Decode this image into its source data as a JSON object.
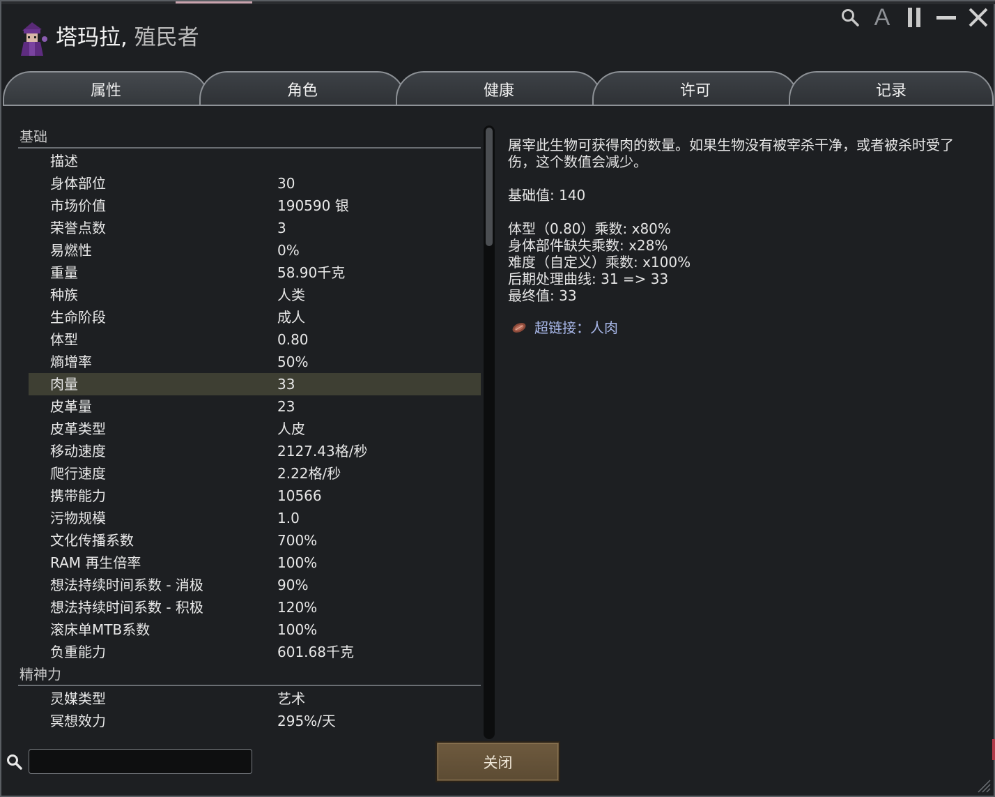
{
  "window": {
    "pawn_name": "塔玛拉",
    "separator": ",",
    "pawn_role": "殖民者",
    "controls": {
      "search_icon": "search-icon",
      "font_label": "A",
      "pause_icon": "pause-icon",
      "minimize_icon": "minimize-icon",
      "close_icon": "close-icon"
    }
  },
  "tabs": [
    {
      "label": "属性",
      "active": true
    },
    {
      "label": "角色",
      "active": false
    },
    {
      "label": "健康",
      "active": false
    },
    {
      "label": "许可",
      "active": false
    },
    {
      "label": "记录",
      "active": false
    }
  ],
  "stats": {
    "categories": [
      {
        "title": "基础",
        "rows": [
          {
            "label": "描述",
            "value": ""
          },
          {
            "label": "身体部位",
            "value": "30"
          },
          {
            "label": "市场价值",
            "value": "190590 银"
          },
          {
            "label": "荣誉点数",
            "value": "3"
          },
          {
            "label": "易燃性",
            "value": "0%"
          },
          {
            "label": "重量",
            "value": "58.90千克"
          },
          {
            "label": "种族",
            "value": "人类"
          },
          {
            "label": "生命阶段",
            "value": "成人"
          },
          {
            "label": "体型",
            "value": "0.80"
          },
          {
            "label": "熵增率",
            "value": "50%"
          },
          {
            "label": "肉量",
            "value": "33",
            "selected": true
          },
          {
            "label": "皮革量",
            "value": "23"
          },
          {
            "label": "皮革类型",
            "value": "人皮"
          },
          {
            "label": "移动速度",
            "value": "2127.43格/秒"
          },
          {
            "label": "爬行速度",
            "value": "2.22格/秒"
          },
          {
            "label": "携带能力",
            "value": "10566"
          },
          {
            "label": "污物规模",
            "value": "1.0"
          },
          {
            "label": "文化传播系数",
            "value": "700%"
          },
          {
            "label": "RAM 再生倍率",
            "value": "100%"
          },
          {
            "label": "想法持续时间系数 - 消极",
            "value": "90%"
          },
          {
            "label": "想法持续时间系数 - 积极",
            "value": "120%"
          },
          {
            "label": "滚床单MTB系数",
            "value": "100%"
          },
          {
            "label": "负重能力",
            "value": "601.68千克"
          }
        ]
      },
      {
        "title": "精神力",
        "rows": [
          {
            "label": "灵媒类型",
            "value": "艺术"
          },
          {
            "label": "冥想效力",
            "value": "295%/天"
          }
        ]
      }
    ]
  },
  "explanation": {
    "description": "屠宰此生物可获得肉的数量。如果生物没有被宰杀干净，或者被杀时受了伤，这个数值会减少。",
    "base_value": "基础值: 140",
    "factors": [
      "体型（0.80）乘数: x80%",
      "身体部件缺失乘数: x28%",
      "难度（自定义）乘数: x100%",
      "后期处理曲线: 31 => 33",
      "最终值: 33"
    ],
    "hyperlink": "超链接：人肉",
    "hyperlink_icon": "meat-icon"
  },
  "footer": {
    "search_value": "",
    "close_label": "关闭"
  },
  "colors": {
    "window_bg": "#1d1f22",
    "selected_row": "#3e3f33",
    "button_brown": "#6e5a3e",
    "link_blue": "#a9b8ea"
  }
}
